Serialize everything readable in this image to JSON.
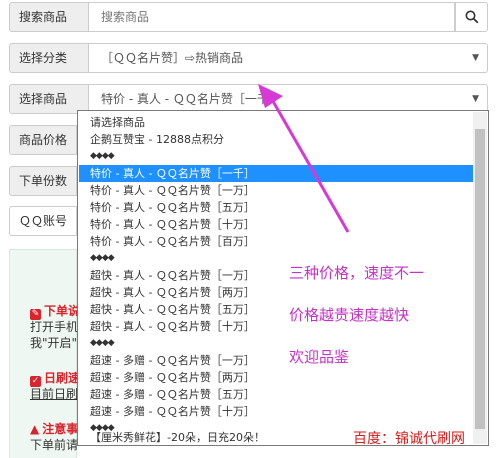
{
  "form": {
    "search": {
      "label": "搜索商品",
      "placeholder": "搜索商品",
      "icon": "search-icon"
    },
    "category": {
      "label": "选择分类",
      "value": "［ＱＱ名片赞］⇨热销商品"
    },
    "product": {
      "label": "选择商品",
      "value": "特价 - 真人 - ＱＱ名片赞［一千"
    },
    "price": {
      "label": "商品价格"
    },
    "quantity": {
      "label": "下单份数"
    },
    "qq": {
      "label": "ＱＱ账号"
    }
  },
  "panel": {
    "note1": "下单说",
    "note1_line2": "打开手机",
    "note1_line3": "我\"开启\"",
    "note2": "日刷速",
    "note2_line2": "目前日刷",
    "note3": "注意事",
    "note3_line2": "下单前请"
  },
  "dropdown": {
    "options": [
      "请选择商品",
      "企鹅互赞宝 - 12888点积分",
      "◆◆◆◆",
      "特价 - 真人 - ＱＱ名片赞［一千］",
      "特价 - 真人 - ＱＱ名片赞［一万］",
      "特价 - 真人 - ＱＱ名片赞［五万］",
      "特价 - 真人 - ＱＱ名片赞［十万］",
      "特价 - 真人 - ＱＱ名片赞［百万］",
      "◆◆◆◆",
      "超快 - 真人 - ＱＱ名片赞［一万］",
      "超快 - 真人 - ＱＱ名片赞［两万］",
      "超快 - 真人 - ＱＱ名片赞［五万］",
      "超快 - 真人 - ＱＱ名片赞［十万］",
      "◆◆◆◆",
      "超速 - 多赠 - ＱＱ名片赞［一万］",
      "超速 - 多赠 - ＱＱ名片赞［两万］",
      "超速 - 多赠 - ＱＱ名片赞［五万］",
      "超速 - 多赠 - ＱＱ名片赞［十万］",
      "◆◆◆◆",
      "【厘米秀鲜花】-20朵，日充20朵！"
    ],
    "selected_index": 3
  },
  "annotations": {
    "line1": "三种价格，速度不一",
    "line2": "价格越贵速度越快",
    "line3": "欢迎品鉴",
    "color": "#c533c5"
  },
  "watermark": "百度：锦诚代刷网",
  "colors": {
    "selection": "#1e90ff",
    "warning_red": "#d9232d",
    "watermark_red": "#d81a1a"
  }
}
